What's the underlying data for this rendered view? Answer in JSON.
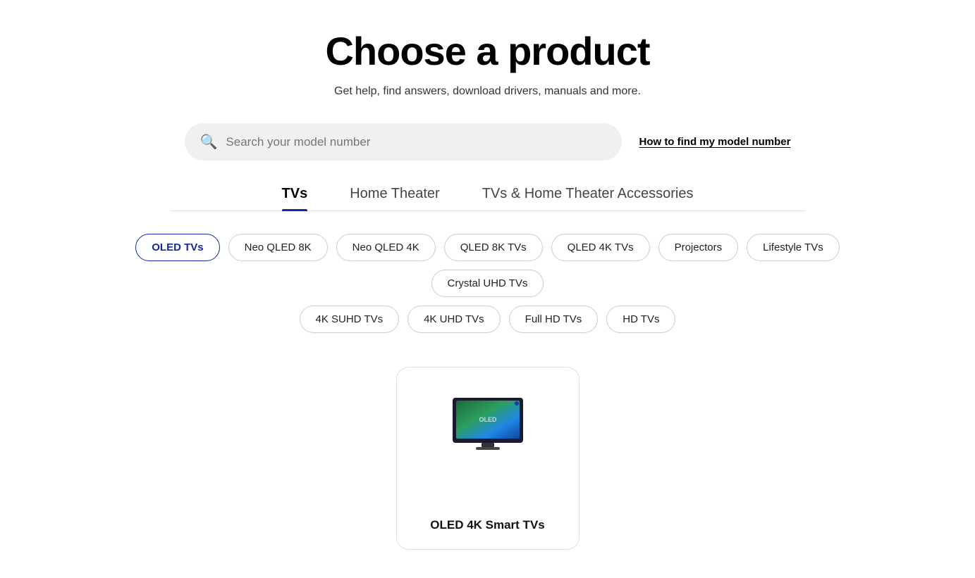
{
  "page": {
    "title": "Choose a product",
    "subtitle": "Get help, find answers, download drivers, manuals and more."
  },
  "search": {
    "placeholder": "Search your model number",
    "model_link": "How to find my model number"
  },
  "tabs": [
    {
      "id": "tvs",
      "label": "TVs",
      "active": true
    },
    {
      "id": "home-theater",
      "label": "Home Theater",
      "active": false
    },
    {
      "id": "accessories",
      "label": "TVs & Home Theater Accessories",
      "active": false
    }
  ],
  "chips_row1": [
    {
      "id": "oled-tvs",
      "label": "OLED TVs",
      "active": true
    },
    {
      "id": "neo-qled-8k",
      "label": "Neo QLED 8K",
      "active": false
    },
    {
      "id": "neo-qled-4k",
      "label": "Neo QLED 4K",
      "active": false
    },
    {
      "id": "qled-8k-tvs",
      "label": "QLED 8K TVs",
      "active": false
    },
    {
      "id": "qled-4k-tvs",
      "label": "QLED 4K TVs",
      "active": false
    },
    {
      "id": "projectors",
      "label": "Projectors",
      "active": false
    },
    {
      "id": "lifestyle-tvs",
      "label": "Lifestyle TVs",
      "active": false
    },
    {
      "id": "crystal-uhd-tvs",
      "label": "Crystal UHD TVs",
      "active": false
    }
  ],
  "chips_row2": [
    {
      "id": "4k-suhd-tvs",
      "label": "4K SUHD TVs",
      "active": false
    },
    {
      "id": "4k-uhd-tvs",
      "label": "4K UHD TVs",
      "active": false
    },
    {
      "id": "full-hd-tvs",
      "label": "Full HD TVs",
      "active": false
    },
    {
      "id": "hd-tvs",
      "label": "HD TVs",
      "active": false
    }
  ],
  "products": [
    {
      "id": "oled-4k-smart-tvs",
      "label": "OLED 4K Smart TVs"
    }
  ]
}
